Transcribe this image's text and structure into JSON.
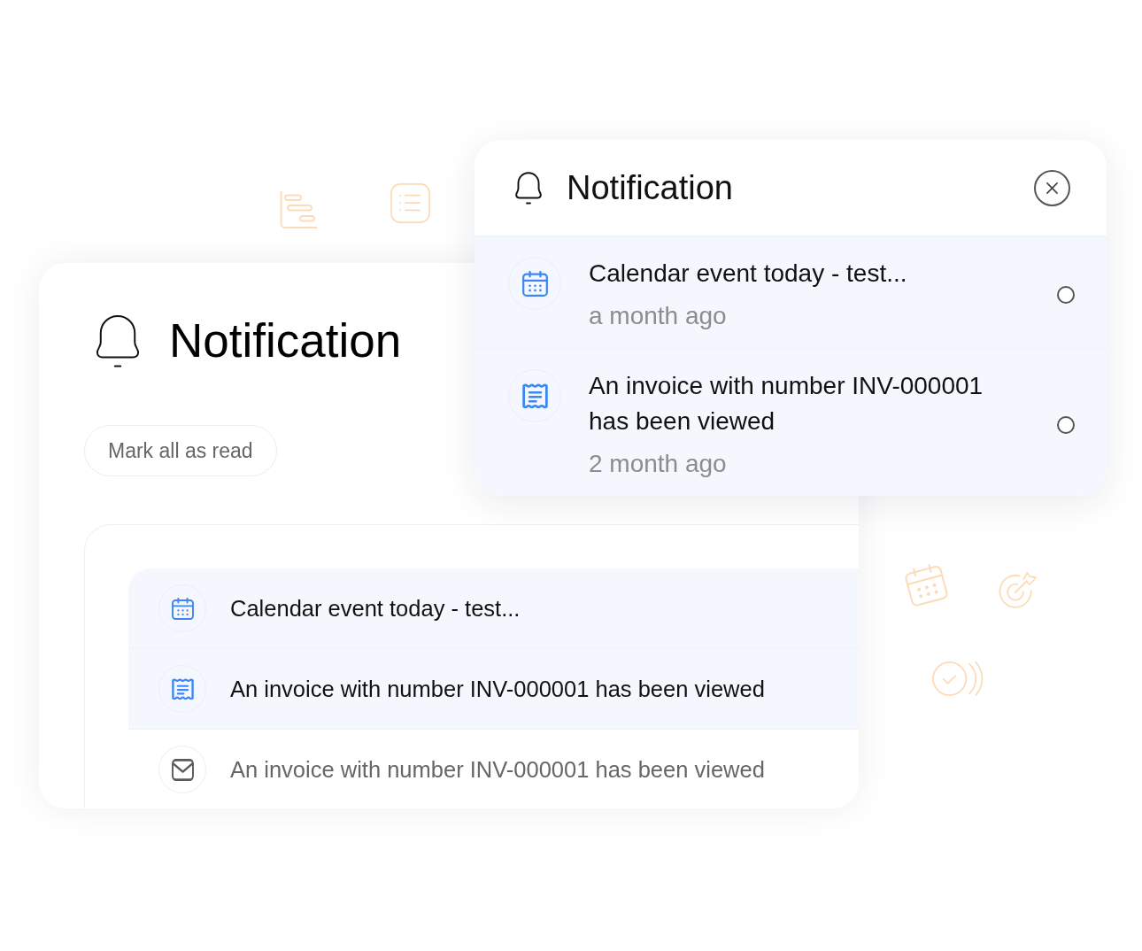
{
  "main_panel": {
    "title": "Notification",
    "mark_all_button": "Mark all as read",
    "notifications": [
      {
        "kind": "calendar",
        "text": "Calendar event today - test...",
        "unread": true
      },
      {
        "kind": "invoice",
        "text": "An invoice with number INV-000001 has been viewed",
        "unread": true
      },
      {
        "kind": "mail",
        "text": "An invoice with number INV-000001 has been viewed",
        "unread": false
      }
    ]
  },
  "popup": {
    "title": "Notification",
    "notifications": [
      {
        "kind": "calendar",
        "text": "Calendar event today - test...",
        "time": "a month ago",
        "unread": true,
        "selected": false
      },
      {
        "kind": "invoice",
        "text": "An invoice with number INV-000001 has been viewed",
        "time": "2 month ago",
        "unread": true,
        "selected": false
      }
    ]
  }
}
